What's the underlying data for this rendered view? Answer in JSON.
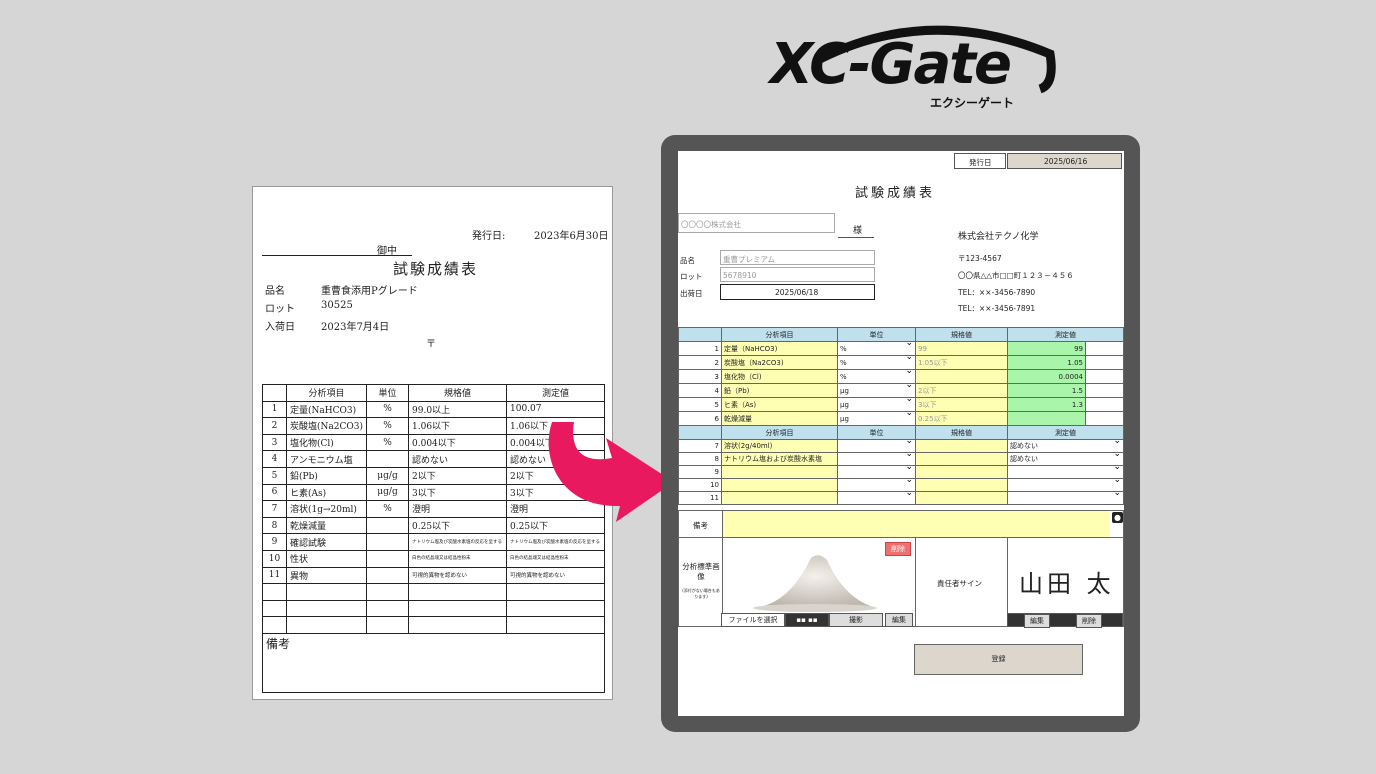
{
  "logo": {
    "text": "XC-Gate",
    "subtitle": "エクシーゲート"
  },
  "paper": {
    "issue_label": "発行日:",
    "issue_date": "2023年6月30日",
    "to_suffix": "御中",
    "title": "試験成績表",
    "product_label": "品名",
    "product_value": "重曹食添用Pグレード",
    "lot_label": "ロット",
    "lot_value": "30525",
    "arrival_label": "入荷日",
    "arrival_value": "2023年7月4日",
    "postal_mark": "〒",
    "headers": [
      "分析項目",
      "単位",
      "規格値",
      "測定値"
    ],
    "rows": [
      {
        "no": "1",
        "item": "定量(NaHCO3)",
        "unit": "%",
        "spec": "99.0以上",
        "value": "100.07"
      },
      {
        "no": "2",
        "item": "炭酸塩(Na2CO3)",
        "unit": "%",
        "spec": "1.06以下",
        "value": "1.06以下"
      },
      {
        "no": "3",
        "item": "塩化物(Cl)",
        "unit": "%",
        "spec": "0.004以下",
        "value": "0.004以下"
      },
      {
        "no": "4",
        "item": "アンモニウム塩",
        "unit": "",
        "spec": "認めない",
        "value": "認めない"
      },
      {
        "no": "5",
        "item": "鉛(Pb)",
        "unit": "μg/g",
        "spec": "2以下",
        "value": "2以下"
      },
      {
        "no": "6",
        "item": "ヒ素(As)",
        "unit": "μg/g",
        "spec": "3以下",
        "value": "3以下"
      },
      {
        "no": "7",
        "item": "溶状(1g→20ml)",
        "unit": "%",
        "spec": "澄明",
        "value": "澄明"
      },
      {
        "no": "8",
        "item": "乾燥減量",
        "unit": "",
        "spec": "0.25以下",
        "value": "0.25以下"
      },
      {
        "no": "9",
        "item": "確認試験",
        "unit": "",
        "spec": "ナトリウム塩及び炭酸水素塩の反応を呈する",
        "value": "ナトリウム塩及び炭酸水素塩の反応を呈する"
      },
      {
        "no": "10",
        "item": "性状",
        "unit": "",
        "spec": "白色の結晶塊又は結晶性粉末",
        "value": "白色の結晶塊又は結晶性粉末"
      },
      {
        "no": "11",
        "item": "異物",
        "unit": "",
        "spec": "可視的異物を認めない",
        "value": "可視的異物を認めない"
      }
    ],
    "remarks_label": "備考"
  },
  "app": {
    "issue_label": "発行日",
    "issue_date": "2025/06/16",
    "title": "試験成績表",
    "customer_placeholder": "〇〇〇〇株式会社",
    "honorific": "様",
    "company_name": "株式会社テクノ化学",
    "postal": "〒123-4567",
    "address": "〇〇県△△市□□町１２３－４５６",
    "tel1": "TEL：××-3456-7890",
    "tel2": "TEL：××-3456-7891",
    "product_label": "品名",
    "product_placeholder": "重曹プレミアム",
    "lot_label": "ロット",
    "lot_placeholder": "5678910",
    "ship_label": "出荷日",
    "ship_date": "2025/06/18",
    "headers": [
      "分析項目",
      "単位",
      "規格値",
      "測定値"
    ],
    "rows1": [
      {
        "no": "1",
        "item": "定量（NaHCO3)",
        "unit": "%",
        "spec": "99",
        "value": "99"
      },
      {
        "no": "2",
        "item": "炭酸塩（Na2CO3)",
        "unit": "%",
        "spec": "1.05以下",
        "value": "1.05"
      },
      {
        "no": "3",
        "item": "塩化物（Cl)",
        "unit": "%",
        "spec": "",
        "value": "0.0004"
      },
      {
        "no": "4",
        "item": "鉛（Pb)",
        "unit": "μg",
        "spec": "2以下",
        "value": "1.5"
      },
      {
        "no": "5",
        "item": "ヒ素（As)",
        "unit": "μg",
        "spec": "3以下",
        "value": "1.3"
      },
      {
        "no": "6",
        "item": "乾燥減量",
        "unit": "μg",
        "spec": "0.25以下",
        "value": ""
      }
    ],
    "rows2": [
      {
        "no": "7",
        "item": "溶状(2g/40ml)",
        "value": "認めない"
      },
      {
        "no": "8",
        "item": "ナトリウム塩および炭酸水素塩",
        "value": "認めない"
      },
      {
        "no": "9",
        "item": "",
        "value": ""
      },
      {
        "no": "10",
        "item": "",
        "value": ""
      },
      {
        "no": "11",
        "item": "",
        "value": ""
      }
    ],
    "remarks_label": "備考",
    "image_label": "分析標準画像",
    "image_note": "(添付がない場合もあります)",
    "delete_label": "削除",
    "file_select_label": "ファイルを選択",
    "capture_label": "撮影",
    "edit_label": "編集",
    "signer_label": "責任者サイン",
    "signature": "山田 太",
    "register_label": "登録"
  },
  "colors": {
    "arrow": "#e8195f",
    "header_blue": "#bfe0ec",
    "input_yellow": "#ffffb3",
    "value_green": "#a9f5a9"
  }
}
